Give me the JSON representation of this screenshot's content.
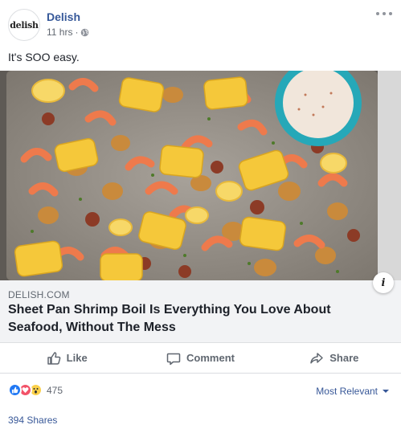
{
  "page": {
    "name": "Delish",
    "avatar_text": "delish"
  },
  "post": {
    "time": "11 hrs",
    "separator": "·",
    "privacy_icon": "globe-icon",
    "text": "It's SOO easy."
  },
  "link": {
    "domain": "DELISH.COM",
    "title": "Sheet Pan Shrimp Boil Is Everything You Love About Seafood, Without The Mess",
    "info_icon": "i"
  },
  "actions": {
    "like": "Like",
    "comment": "Comment",
    "share": "Share"
  },
  "reactions": {
    "icons": [
      "like-icon",
      "love-icon",
      "wow-icon"
    ],
    "count": "475"
  },
  "comments_sort": {
    "label": "Most Relevant"
  },
  "shares": {
    "label": "394 Shares"
  },
  "colors": {
    "link_blue": "#385898",
    "name_blue": "#365899",
    "like_blue": "#2078f4",
    "love_red": "#f25268",
    "wow_yellow": "#fbd04a"
  }
}
